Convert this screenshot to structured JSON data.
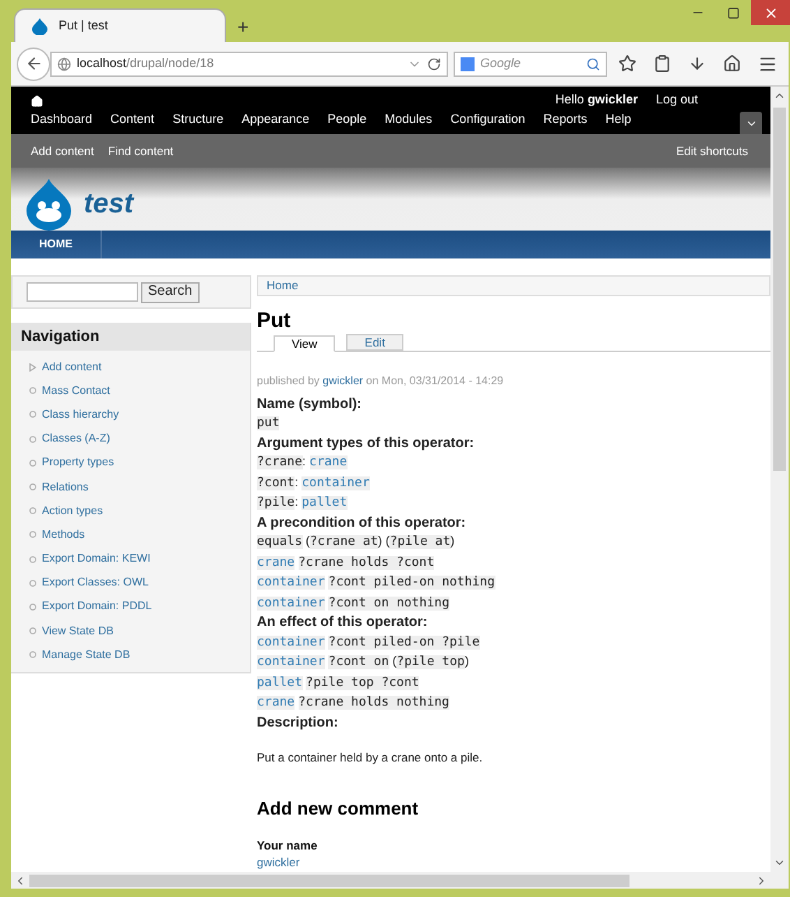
{
  "browser": {
    "tab_title": "Put | test",
    "new_tab": "+",
    "url_host": "localhost",
    "url_path": "/drupal/node/18",
    "search_placeholder": "Google"
  },
  "admin_bar": {
    "greeting": "Hello",
    "user": "gwickler",
    "logout": "Log out",
    "menu": [
      "Dashboard",
      "Content",
      "Structure",
      "Appearance",
      "People",
      "Modules",
      "Configuration",
      "Reports",
      "Help"
    ]
  },
  "shortcuts": {
    "items": [
      "Add content",
      "Find content"
    ],
    "edit": "Edit shortcuts"
  },
  "site": {
    "name": "test"
  },
  "main_nav": [
    {
      "label": "HOME",
      "selected": true
    }
  ],
  "sidebar": {
    "search_button": "Search",
    "nav_title": "Navigation",
    "items": [
      {
        "label": "Add content",
        "kind": "collapsed"
      },
      {
        "label": "Mass Contact",
        "kind": "leaf"
      },
      {
        "label": "Class hierarchy",
        "kind": "leaf"
      },
      {
        "label": "Classes (A-Z)",
        "kind": "leaf"
      },
      {
        "label": "Property types",
        "kind": "leaf"
      },
      {
        "label": "Relations",
        "kind": "leaf"
      },
      {
        "label": "Action types",
        "kind": "leaf"
      },
      {
        "label": "Methods",
        "kind": "leaf"
      },
      {
        "label": "Export Domain: KEWI",
        "kind": "leaf"
      },
      {
        "label": "Export Classes: OWL",
        "kind": "leaf"
      },
      {
        "label": "Export Domain: PDDL",
        "kind": "leaf"
      },
      {
        "label": "View State DB",
        "kind": "leaf"
      },
      {
        "label": "Manage State DB",
        "kind": "leaf"
      }
    ]
  },
  "content": {
    "breadcrumb": "Home",
    "title": "Put",
    "tabs": [
      {
        "label": "View",
        "selected": true
      },
      {
        "label": "Edit",
        "selected": false
      }
    ],
    "submitted": {
      "prefix": "published by",
      "author": "gwickler",
      "suffix": "on Mon, 03/31/2014 - 14:29"
    },
    "fields": [
      {
        "kind": "label",
        "text": "Name (symbol):"
      },
      {
        "kind": "line",
        "parts": [
          {
            "kind": "code",
            "text": "put"
          }
        ]
      },
      {
        "kind": "label",
        "text": "Argument types of this operator:"
      },
      {
        "kind": "line",
        "parts": [
          {
            "kind": "code",
            "text": "?crane"
          },
          {
            "kind": "plain",
            "text": ": "
          },
          {
            "kind": "link",
            "text": "crane"
          }
        ]
      },
      {
        "kind": "line",
        "parts": [
          {
            "kind": "code",
            "text": "?cont"
          },
          {
            "kind": "plain",
            "text": ": "
          },
          {
            "kind": "link",
            "text": "container"
          }
        ]
      },
      {
        "kind": "line",
        "parts": [
          {
            "kind": "code",
            "text": "?pile"
          },
          {
            "kind": "plain",
            "text": ": "
          },
          {
            "kind": "link",
            "text": "pallet"
          }
        ]
      },
      {
        "kind": "label",
        "text": "A precondition of this operator:"
      },
      {
        "kind": "line",
        "parts": [
          {
            "kind": "code",
            "text": "equals"
          },
          {
            "kind": "plain",
            "text": " ("
          },
          {
            "kind": "code",
            "text": "?crane at"
          },
          {
            "kind": "plain",
            "text": ") ("
          },
          {
            "kind": "code",
            "text": "?pile at"
          },
          {
            "kind": "plain",
            "text": ")"
          }
        ]
      },
      {
        "kind": "line",
        "parts": [
          {
            "kind": "link",
            "text": "crane"
          },
          {
            "kind": "code",
            "text": "?crane holds ?cont"
          }
        ]
      },
      {
        "kind": "line",
        "parts": [
          {
            "kind": "link",
            "text": "container"
          },
          {
            "kind": "code",
            "text": "?cont piled-on nothing"
          }
        ]
      },
      {
        "kind": "line",
        "parts": [
          {
            "kind": "link",
            "text": "container"
          },
          {
            "kind": "code",
            "text": "?cont on nothing"
          }
        ]
      },
      {
        "kind": "label",
        "text": "An effect of this operator:"
      },
      {
        "kind": "line",
        "parts": [
          {
            "kind": "link",
            "text": "container"
          },
          {
            "kind": "code",
            "text": "?cont piled-on ?pile"
          }
        ]
      },
      {
        "kind": "line",
        "parts": [
          {
            "kind": "link",
            "text": "container"
          },
          {
            "kind": "code",
            "text": "?cont on"
          },
          {
            "kind": "plain",
            "text": " ("
          },
          {
            "kind": "code",
            "text": "?pile top"
          },
          {
            "kind": "plain",
            "text": ")"
          }
        ]
      },
      {
        "kind": "line",
        "parts": [
          {
            "kind": "link",
            "text": "pallet"
          },
          {
            "kind": "code",
            "text": "?pile top ?cont"
          }
        ]
      },
      {
        "kind": "line",
        "parts": [
          {
            "kind": "link",
            "text": "crane"
          },
          {
            "kind": "code",
            "text": "?crane holds nothing"
          }
        ]
      },
      {
        "kind": "label",
        "text": "Description:"
      }
    ],
    "description": "Put a container held by a crane onto a pile.",
    "comment": {
      "title": "Add new comment",
      "name_label": "Your name",
      "name_value": "gwickler"
    }
  }
}
